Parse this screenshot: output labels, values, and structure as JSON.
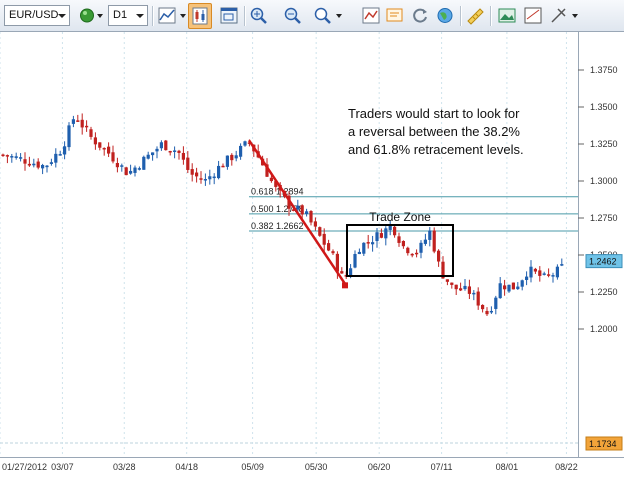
{
  "toolbar": {
    "symbol": "EUR/USD",
    "timeframe": "D1",
    "buttons": [
      {
        "name": "chart-status-icon",
        "color": "#3a9a35"
      },
      {
        "name": "line-chart-icon",
        "color": "#2c5fa8"
      },
      {
        "name": "candlestick-chart-icon",
        "color": "#c0392b",
        "active": true
      },
      {
        "name": "chart-window-icon",
        "color": "#2c5fa8"
      },
      {
        "name": "zoom-in-icon",
        "color": "#2c5fa8"
      },
      {
        "name": "zoom-out-icon",
        "color": "#2c5fa8"
      },
      {
        "name": "zoom-level-icon",
        "color": "#2c5fa8"
      },
      {
        "name": "indicator-icon",
        "color": "#c0392b"
      },
      {
        "name": "alert-icon",
        "color": "#e08a1e"
      },
      {
        "name": "refresh-icon",
        "color": "#6b7b8c"
      },
      {
        "name": "globe-icon",
        "color": "#2c7fd0"
      },
      {
        "name": "ruler-icon",
        "color": "#d4a020"
      },
      {
        "name": "screenshot-icon",
        "color": "#2e8b57"
      },
      {
        "name": "template-icon",
        "color": "#555555"
      },
      {
        "name": "drawing-tools-icon",
        "color": "#555555"
      }
    ]
  },
  "chart": {
    "symbol": "EUR/USD",
    "timeframe": "D1",
    "colors": {
      "bullish": "#1f5fae",
      "bearish": "#c0211f",
      "fib_line": "#4a9aa8",
      "trend_line": "#d01818",
      "last_price_tag": "#6fc3e8",
      "low_tag": "#f2a43a",
      "grid": "#cfe3ec"
    },
    "y_ticks": [
      "1.3750",
      "1.3500",
      "1.3250",
      "1.3000",
      "1.2750",
      "1.2500",
      "1.2250",
      "1.2000"
    ],
    "y_tick_values": [
      1.375,
      1.35,
      1.325,
      1.3,
      1.275,
      1.25,
      1.225,
      1.2
    ],
    "x_ticks": [
      "01/27/2012",
      "03/07",
      "03/28",
      "04/18",
      "05/09",
      "05/30",
      "06/20",
      "07/11",
      "08/01",
      "08/22"
    ],
    "x_tick_positions": [
      0,
      0.108,
      0.215,
      0.323,
      0.437,
      0.547,
      0.656,
      0.764,
      0.877,
      0.98
    ],
    "last_price": "1.2462",
    "low_tag": "1.1734",
    "fib_levels": [
      {
        "label": "0.618 1.2894",
        "value": 1.2894
      },
      {
        "label": "0.500 1.2778",
        "value": 1.2778
      },
      {
        "label": "0.382 1.2662",
        "value": 1.2662
      }
    ],
    "trade_zone_label": "Trade Zone",
    "note_lines": [
      "Traders would start to look for",
      "a reversal between the 38.2%",
      "and 61.8% retracement levels."
    ],
    "swing_high": 1.3275,
    "swing_low": 1.2295
  }
}
